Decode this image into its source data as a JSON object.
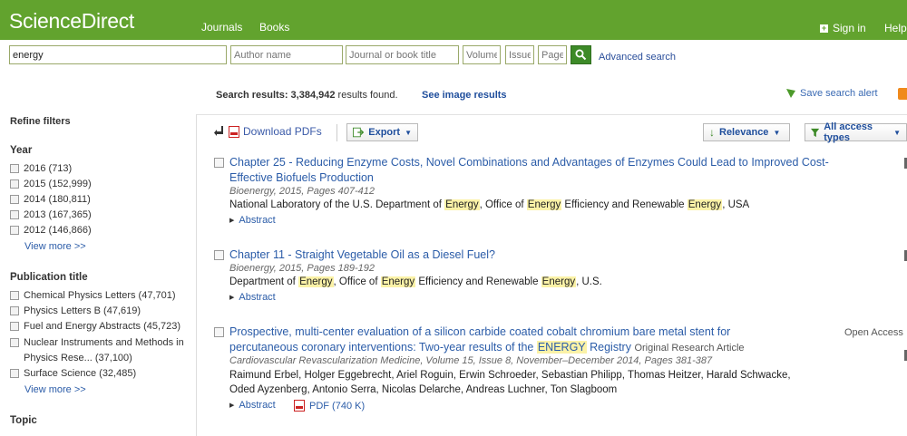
{
  "header": {
    "logo": "ScienceDirect",
    "nav": [
      "Journals",
      "Books"
    ],
    "sign_in": "Sign in",
    "help": "Help"
  },
  "search": {
    "query": "energy",
    "author_placeholder": "Author name",
    "journal_placeholder": "Journal or book title",
    "volume_placeholder": "Volume",
    "issue_placeholder": "Issue",
    "page_placeholder": "Page",
    "advanced": "Advanced search"
  },
  "results_bar": {
    "prefix": "Search results:",
    "count": "3,384,942",
    "suffix": "results found.",
    "see_images": "See image results",
    "save_alert": "Save search alert"
  },
  "sidebar": {
    "title": "Refine filters",
    "year": {
      "label": "Year",
      "items": [
        "2016 (713)",
        "2015 (152,999)",
        "2014 (180,811)",
        "2013 (167,365)",
        "2012 (146,866)"
      ],
      "more": "View more >>"
    },
    "publication": {
      "label": "Publication title",
      "items": [
        "Chemical Physics Letters (47,701)",
        "Physics Letters B (47,619)",
        "Fuel and Energy Abstracts (45,723)",
        "Nuclear Instruments and Methods in",
        "Physics Rese... (37,100)",
        "Surface Science (32,485)"
      ],
      "more": "View more >>"
    },
    "topic": {
      "label": "Topic"
    }
  },
  "toolbar": {
    "download": "Download PDFs",
    "export": "Export",
    "relevance": "Relevance",
    "access": "All access types"
  },
  "results": [
    {
      "title_line1": "Chapter 25 - Reducing Enzyme Costs, Novel Combinations and Advantages of Enzymes Could Lead to Improved Cost-",
      "title_line2": "Effective Biofuels Production",
      "meta": "Bioenergy, 2015, Pages 407-412",
      "auth": [
        "National Laboratory of the U.S. Department of ",
        "Energy",
        ", Office of ",
        "Energy",
        " Efficiency and Renewable ",
        "Energy",
        ", USA"
      ],
      "abstract": "Abstract"
    },
    {
      "title_line1": "Chapter 11 - Straight Vegetable Oil as a Diesel Fuel?",
      "meta": "Bioenergy, 2015, Pages 189-192",
      "auth": [
        "Department of ",
        "Energy",
        ", Office of ",
        "Energy",
        " Efficiency and Renewable ",
        "Energy",
        ", U.S."
      ],
      "abstract": "Abstract"
    },
    {
      "title_line1": "Prospective, multi-center evaluation of a silicon carbide coated cobalt chromium bare metal stent for",
      "title_line2_pre": "percutaneous coronary interventions: Two-year results of the ",
      "title_line2_hl": "ENERGY",
      "title_line2_post": " Registry",
      "type": "Original Research Article",
      "open_access": "Open Access",
      "meta": "Cardiovascular Revascularization Medicine, Volume 15, Issue 8, November–December 2014, Pages 381-387",
      "auth1": "Raimund Erbel, Holger Eggebrecht, Ariel Roguin, Erwin Schroeder, Sebastian Philipp, Thomas Heitzer, Harald Schwacke,",
      "auth2": "Oded Ayzenberg, Antonio Serra, Nicolas Delarche, Andreas Luchner, Ton Slagboom",
      "abstract": "Abstract",
      "pdf": "PDF (740 K)"
    }
  ],
  "colors": {
    "brand": "#62a32e",
    "link": "#2b5ca8",
    "highlight": "#fbf2a7"
  }
}
